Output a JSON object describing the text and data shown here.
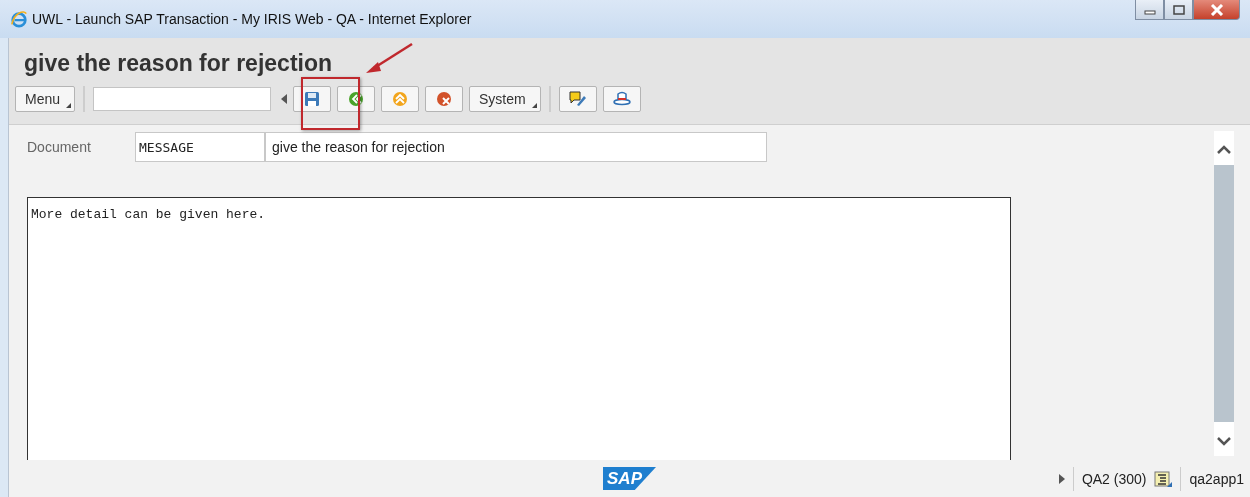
{
  "window": {
    "title": "UWL - Launch SAP Transaction - My IRIS Web - QA - Internet Explorer"
  },
  "page": {
    "title": "give the reason for rejection"
  },
  "toolbar": {
    "menu_label": "Menu",
    "system_label": "System"
  },
  "document": {
    "label": "Document",
    "type_value": "MESSAGE",
    "description_value": "give the reason for rejection"
  },
  "editor": {
    "text": "More detail can be given here."
  },
  "footer": {
    "logo": "SAP",
    "system": "QA2 (300)",
    "server": "qa2app1"
  }
}
